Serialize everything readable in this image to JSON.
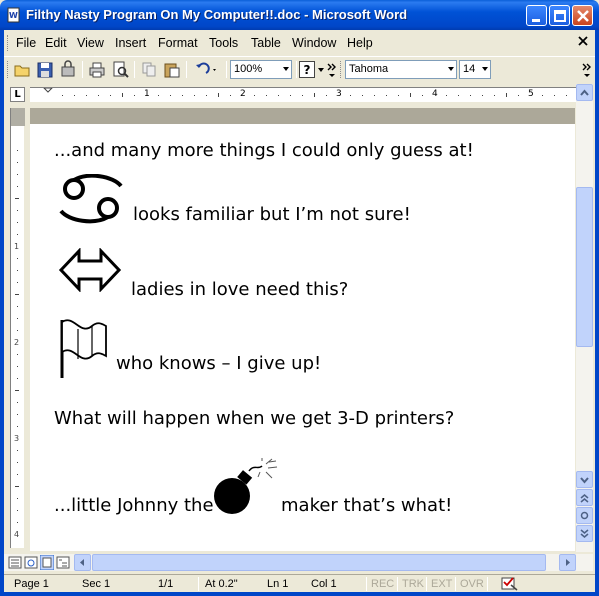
{
  "window": {
    "title": "Filthy Nasty Program On My Computer!!.doc - Microsoft Word"
  },
  "menu": {
    "items": [
      "File",
      "Edit",
      "View",
      "Insert",
      "Format",
      "Tools",
      "Table",
      "Window",
      "Help"
    ]
  },
  "toolbar": {
    "zoom": "100%",
    "font_name": "Tahoma",
    "font_size": "14",
    "help_label": "?"
  },
  "ruler": {
    "numbers": [
      "1",
      "2",
      "3",
      "4",
      "5"
    ],
    "corner": "L"
  },
  "document": {
    "line1": "...and many more things I could only guess at!",
    "line2": "looks familiar but I’m not sure!",
    "line3": "ladies in love need this?",
    "line4": "who knows – I give up!",
    "line5": "What will happen when we get 3-D printers?",
    "line6a": "...little Johnny the",
    "line6b": "maker that’s what!"
  },
  "icons": [
    "cancer-zodiac-icon",
    "double-arrow-icon",
    "flag-icon",
    "bomb-icon"
  ],
  "statusbar": {
    "page": "Page 1",
    "sec": "Sec 1",
    "pages": "1/1",
    "at": "At 0.2\"",
    "ln": "Ln 1",
    "col": "Col 1",
    "rec": "REC",
    "trk": "TRK",
    "ext": "EXT",
    "ovr": "OVR"
  },
  "colors": {
    "titlebar": "#0046c8",
    "chrome": "#ece9d8"
  }
}
